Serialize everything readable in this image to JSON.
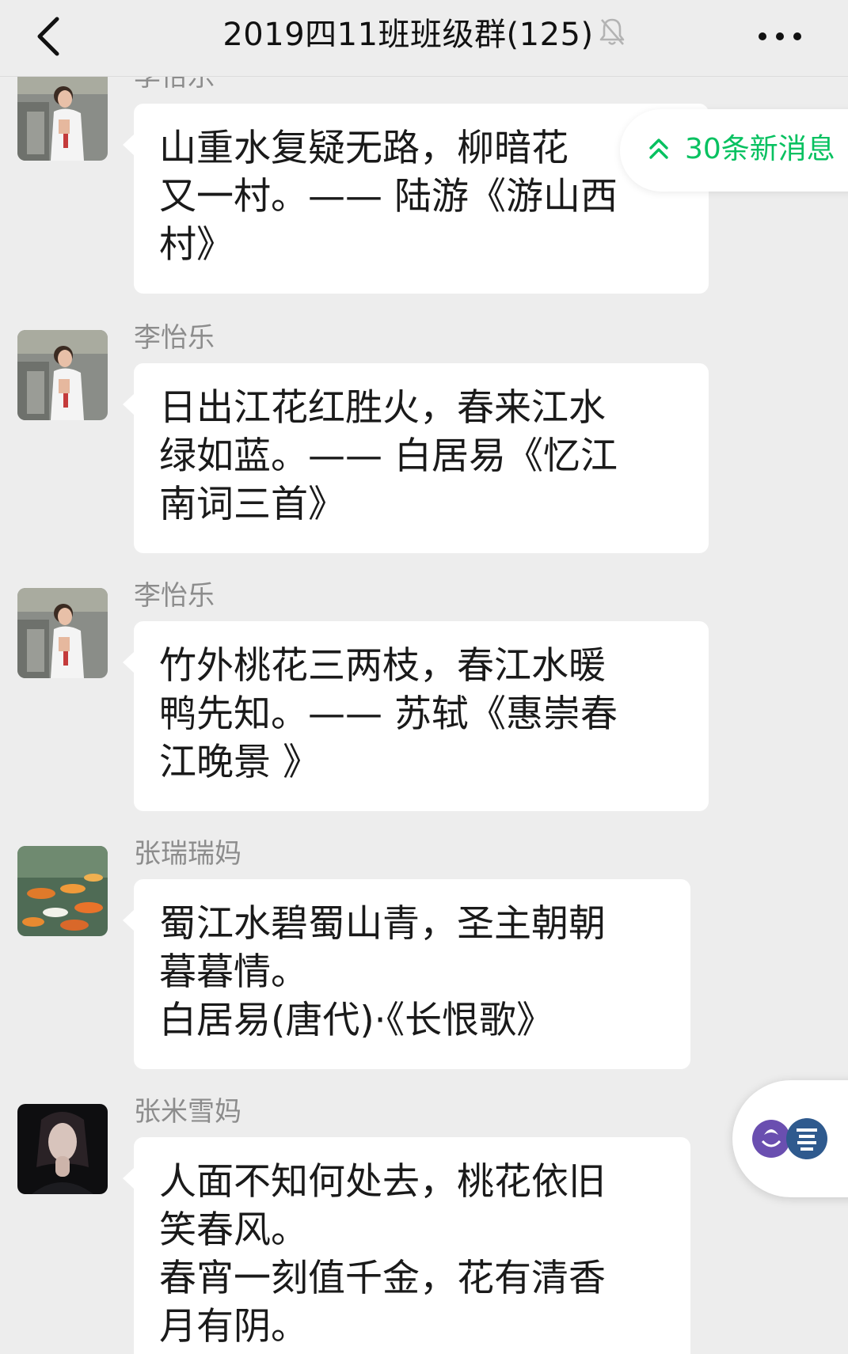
{
  "header": {
    "title": "2019四11班班级群(125)",
    "back_icon": "chevron-left-icon",
    "mute_icon": "bell-off-icon",
    "more_icon": "more-dots-icon"
  },
  "new_messages": {
    "label": "30条新消息",
    "icon": "double-chevron-up-icon",
    "color": "#07c160"
  },
  "messages": [
    {
      "sender": "李怡乐",
      "lines": [
        "山重水复疑无路，柳暗花",
        "又一村。—— 陆游《游山西",
        "村》"
      ]
    },
    {
      "sender": "李怡乐",
      "lines": [
        "日出江花红胜火，春来江水",
        "绿如蓝。—— 白居易《忆江",
        "南词三首》"
      ]
    },
    {
      "sender": "李怡乐",
      "lines": [
        "竹外桃花三两枝，春江水暖",
        "鸭先知。—— 苏轼《惠崇春",
        "江晚景 》"
      ]
    },
    {
      "sender": "张瑞瑞妈",
      "lines": [
        "蜀江水碧蜀山青，圣主朝朝",
        "暮暮情。",
        "白居易(唐代)·《长恨歌》"
      ]
    },
    {
      "sender": "张米雪妈",
      "lines": [
        "人面不知何处去，桃花依旧",
        "笑春风。",
        "春宵一刻值千金，花有清香",
        "月有阴。"
      ]
    }
  ],
  "floating_button": {
    "icon": "reading-app-logo-icon"
  }
}
